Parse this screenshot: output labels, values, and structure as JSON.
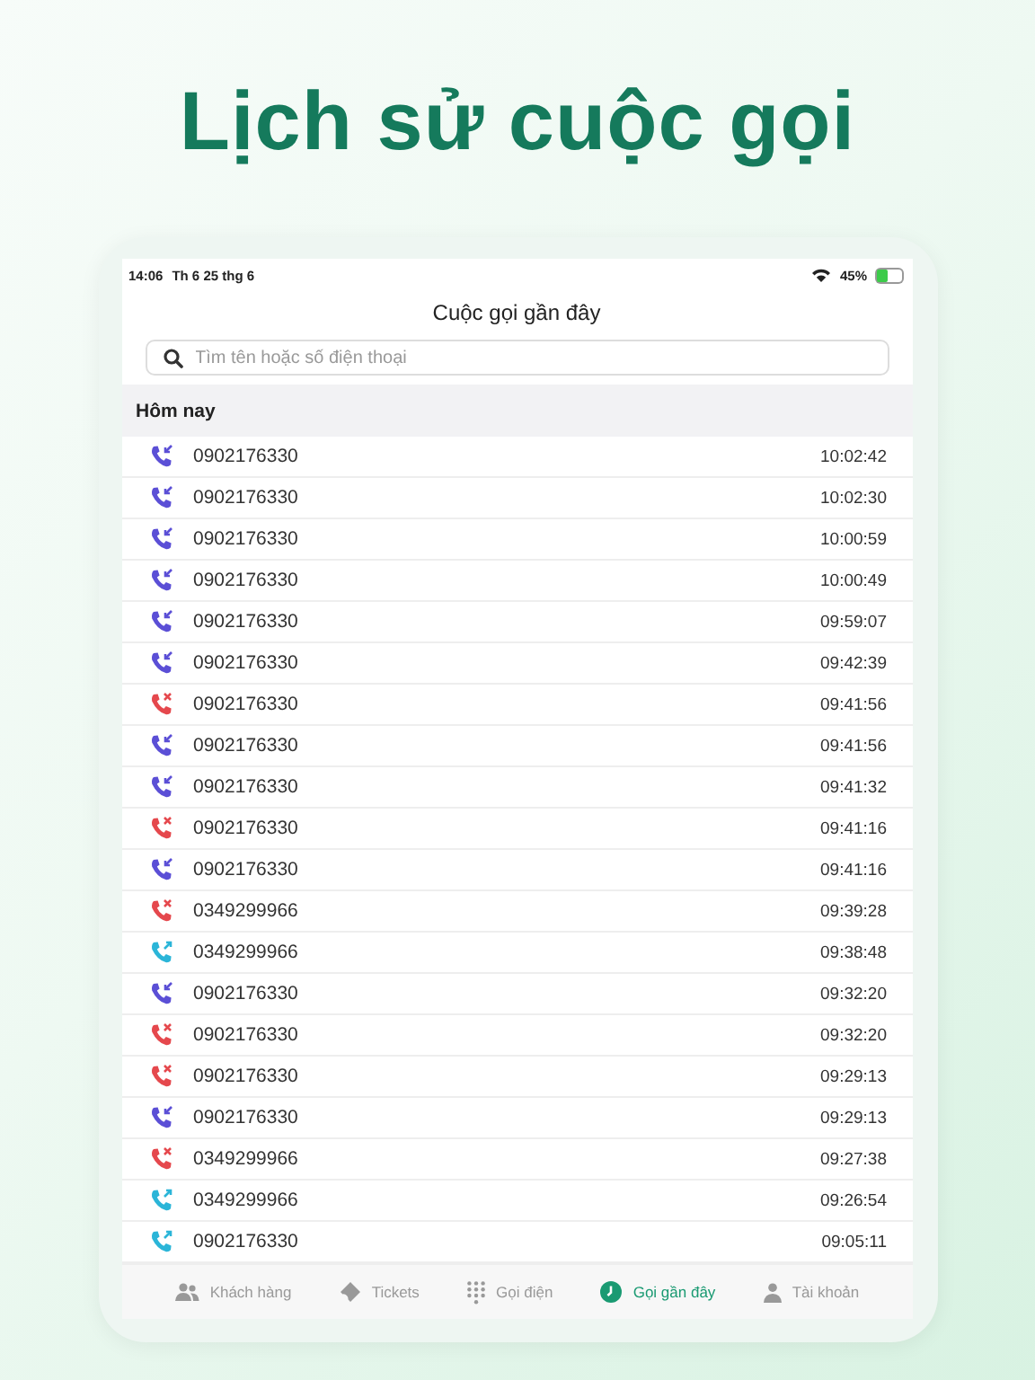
{
  "headline": "Lịch sử cuộc gọi",
  "status_bar": {
    "time": "14:06",
    "date": "Th 6 25 thg 6",
    "battery_text": "45%",
    "battery": {
      "level": 0.45
    }
  },
  "title": "Cuộc gọi gần đây",
  "search": {
    "placeholder": "Tìm tên hoặc số điện thoại"
  },
  "section": "Hôm nay",
  "calls": [
    {
      "kind": "incoming",
      "number": "0902176330",
      "time": "10:02:42"
    },
    {
      "kind": "incoming",
      "number": "0902176330",
      "time": "10:02:30"
    },
    {
      "kind": "incoming",
      "number": "0902176330",
      "time": "10:00:59"
    },
    {
      "kind": "incoming",
      "number": "0902176330",
      "time": "10:00:49"
    },
    {
      "kind": "incoming",
      "number": "0902176330",
      "time": "09:59:07"
    },
    {
      "kind": "incoming",
      "number": "0902176330",
      "time": "09:42:39"
    },
    {
      "kind": "missed",
      "number": "0902176330",
      "time": "09:41:56"
    },
    {
      "kind": "incoming",
      "number": "0902176330",
      "time": "09:41:56"
    },
    {
      "kind": "incoming",
      "number": "0902176330",
      "time": "09:41:32"
    },
    {
      "kind": "missed",
      "number": "0902176330",
      "time": "09:41:16"
    },
    {
      "kind": "incoming",
      "number": "0902176330",
      "time": "09:41:16"
    },
    {
      "kind": "missed",
      "number": "0349299966",
      "time": "09:39:28"
    },
    {
      "kind": "outgoing",
      "number": "0349299966",
      "time": "09:38:48"
    },
    {
      "kind": "incoming",
      "number": "0902176330",
      "time": "09:32:20"
    },
    {
      "kind": "missed",
      "number": "0902176330",
      "time": "09:32:20"
    },
    {
      "kind": "missed",
      "number": "0902176330",
      "time": "09:29:13"
    },
    {
      "kind": "incoming",
      "number": "0902176330",
      "time": "09:29:13"
    },
    {
      "kind": "missed",
      "number": "0349299966",
      "time": "09:27:38"
    },
    {
      "kind": "outgoing",
      "number": "0349299966",
      "time": "09:26:54"
    },
    {
      "kind": "outgoing",
      "number": "0902176330",
      "time": "09:05:11"
    }
  ],
  "tabs": [
    {
      "kind": "people",
      "label": "Khách hàng",
      "selected": false
    },
    {
      "kind": "ticket",
      "label": "Tickets",
      "selected": false
    },
    {
      "kind": "keypad",
      "label": "Gọi điện",
      "selected": false
    },
    {
      "kind": "clock",
      "label": "Gọi gần đây",
      "selected": true
    },
    {
      "kind": "person",
      "label": "Tài khoản",
      "selected": false
    }
  ]
}
